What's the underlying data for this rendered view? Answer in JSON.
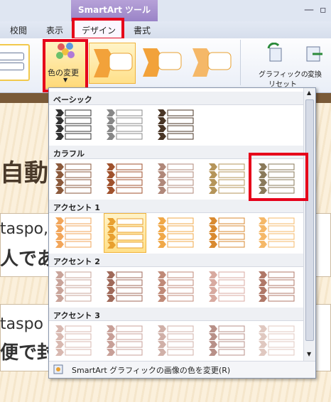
{
  "window": {
    "context_tab_title": "SmartArt ツール",
    "minimize": "—",
    "restore": "▫"
  },
  "tabs": [
    {
      "label": "校閲"
    },
    {
      "label": "表示"
    },
    {
      "label": "デザイン"
    },
    {
      "label": "書式"
    }
  ],
  "ribbon": {
    "change_colors_label": "色の変更",
    "reset_label_line1": "グラフィックの",
    "reset_label_line2": "リセット",
    "convert_label": "変換"
  },
  "slide": {
    "title_fragment": "自動",
    "line1": "taspo,",
    "line2": "人であ",
    "line3": "taspo",
    "line4": "便で封"
  },
  "gallery": {
    "sections": [
      {
        "name": "ベーシック"
      },
      {
        "name": "カラフル"
      },
      {
        "name": "アクセント 1"
      },
      {
        "name": "アクセント 2"
      },
      {
        "name": "アクセント 3"
      }
    ],
    "footer_label": "SmartArt グラフィックの画像の色を変更(R)"
  },
  "colors": {
    "basic": [
      "#333333",
      "#888888",
      "#4a3626"
    ],
    "colorful": [
      "#8b5a3c",
      "#a0522d",
      "#b0887a",
      "#b5955a",
      "#8a7a5a"
    ],
    "accent1": [
      "#f2a65a",
      "#e8a030",
      "#f0a848",
      "#d98a30",
      "#f5b868"
    ],
    "accent2": [
      "#c9a49a",
      "#a06a5a",
      "#c08a78",
      "#d8aaa0",
      "#b07868"
    ],
    "accent3": [
      "#d8b8b0",
      "#c8a098",
      "#d0b0a8",
      "#b89088",
      "#e0c8c0"
    ],
    "red_highlight": "#e6001a"
  }
}
